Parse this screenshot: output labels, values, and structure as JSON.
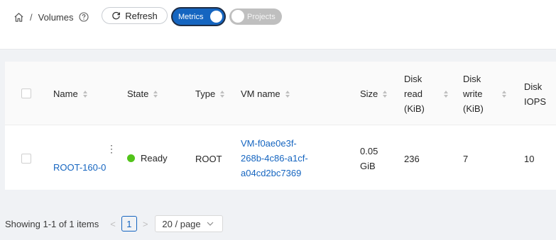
{
  "breadcrumb": {
    "separator": "/",
    "current": "Volumes"
  },
  "toolbar": {
    "refresh_label": "Refresh",
    "metrics_label": "Metrics",
    "projects_label": "Projects",
    "metrics_on": true,
    "projects_on": false
  },
  "table": {
    "columns": {
      "name": "Name",
      "state": "State",
      "type": "Type",
      "vm_name": "VM name",
      "size": "Size",
      "disk_read": [
        "Disk",
        "read",
        "(KiB)"
      ],
      "disk_write": [
        "Disk",
        "write",
        "(KiB)"
      ],
      "disk_iops": [
        "Disk",
        "IOPS"
      ]
    },
    "rows": [
      {
        "name": "ROOT-160-0",
        "state": "Ready",
        "type": "ROOT",
        "vm_name_lines": [
          "VM-f0ae0e3f-",
          "268b-4c86-a1cf-",
          "a04cd2bc7369"
        ],
        "size_lines": [
          "0.05",
          "GiB"
        ],
        "disk_read": "236",
        "disk_write": "7",
        "disk_iops": "10",
        "menu_glyph": "⋮"
      }
    ]
  },
  "pagination": {
    "summary": "Showing 1-1 of 1 items",
    "current_page": "1",
    "page_size": "20 / page",
    "prev": "<",
    "next": ">"
  },
  "colors": {
    "accent": "#1565c0",
    "ready": "#52c41a",
    "toggle_off": "#bfbfbf"
  }
}
